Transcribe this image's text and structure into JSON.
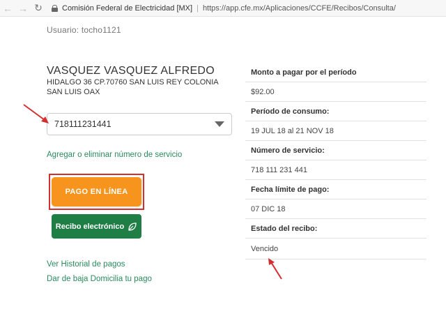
{
  "browser": {
    "site_name": "Comisión Federal de Electricidad [MX]",
    "separator": "|",
    "url": "https://app.cfe.mx/Aplicaciones/CCFE/Recibos/Consulta/"
  },
  "user": {
    "label": "Usuario:  tocho1121"
  },
  "customer": {
    "name": "VASQUEZ VASQUEZ ALFREDO",
    "address": "HIDALGO 36 CP.70760 SAN LUIS REY COLONIA SAN LUIS OAX"
  },
  "service_select": {
    "value": "718111231441"
  },
  "links": {
    "add_remove": "Agregar o eliminar número de servicio",
    "history": "Ver Historial de pagos",
    "unsubscribe": "Dar de baja Domicilia tu pago"
  },
  "buttons": {
    "pay_online": "PAGO EN LÍNEA",
    "electronic_receipt": "Recibo electrónico"
  },
  "summary": [
    {
      "label": "Monto a pagar por el período",
      "value": "$92.00"
    },
    {
      "label": "Período de consumo:",
      "value": "19 JUL 18 al 21 NOV 18"
    },
    {
      "label": "Número de servicio:",
      "value": "718 111 231 441"
    },
    {
      "label": "Fecha límite de pago:",
      "value": "07 DIC 18"
    },
    {
      "label": "Estado del recibo:",
      "value": "Vencido"
    }
  ],
  "colors": {
    "pay_button": "#f7941d",
    "receipt_button": "#1e7e45",
    "link": "#2a8a5e",
    "annotation": "#d32f2f"
  }
}
